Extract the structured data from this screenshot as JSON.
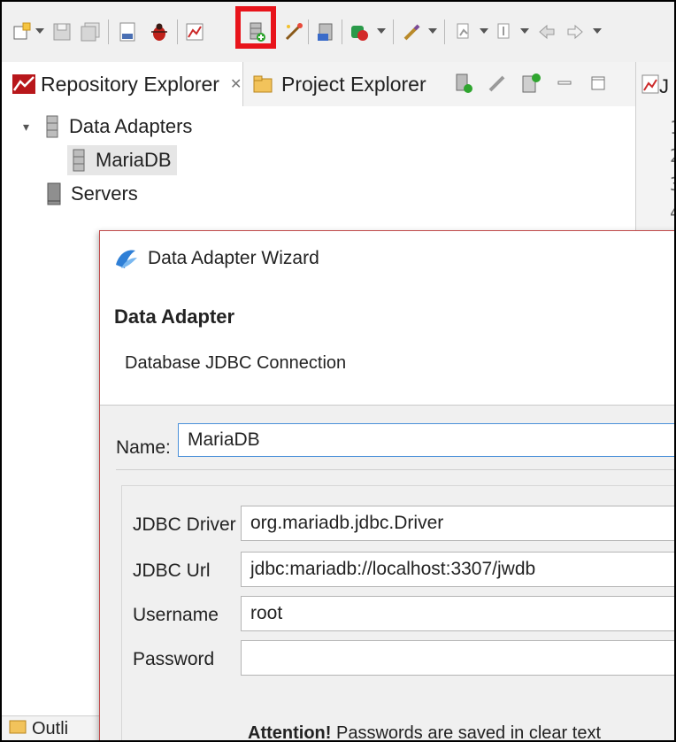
{
  "toolbar": {
    "icons": [
      "new-icon",
      "save-icon",
      "save-all-icon",
      "compile-icon",
      "bug-icon",
      "report-icon",
      "new-data-adapter-icon",
      "wizard-icon",
      "export-icon",
      "run-icon",
      "pen-icon",
      "step-icon",
      "step-over-icon",
      "back-icon",
      "forward-icon"
    ],
    "highlight_color": "#e8141b"
  },
  "views": {
    "active_tab": "Repository Explorer",
    "active_close_glyph": "✕",
    "inactive_tab": "Project Explorer"
  },
  "tree": {
    "items": [
      {
        "label": "Data Adapters",
        "expanded": true
      },
      {
        "label": "MariaDB",
        "selected": true
      },
      {
        "label": "Servers"
      }
    ]
  },
  "editor": {
    "tab_label": "J",
    "line_numbers": [
      "1",
      "2",
      "3",
      "4"
    ]
  },
  "outline": {
    "label": "Outli"
  },
  "dialog": {
    "title": "Data Adapter Wizard",
    "heading": "Data Adapter",
    "description": "Database JDBC Connection",
    "name_label": "Name:",
    "name_value": "MariaDB",
    "fields": [
      {
        "label": "JDBC Driver",
        "value": "org.mariadb.jdbc.Driver"
      },
      {
        "label": "JDBC Url",
        "value": "jdbc:mariadb://localhost:3307/jwdb"
      },
      {
        "label": "Username",
        "value": "root"
      },
      {
        "label": "Password",
        "value": ""
      }
    ],
    "attention_bold": "Attention!",
    "attention_text": " Passwords are saved in clear text"
  }
}
